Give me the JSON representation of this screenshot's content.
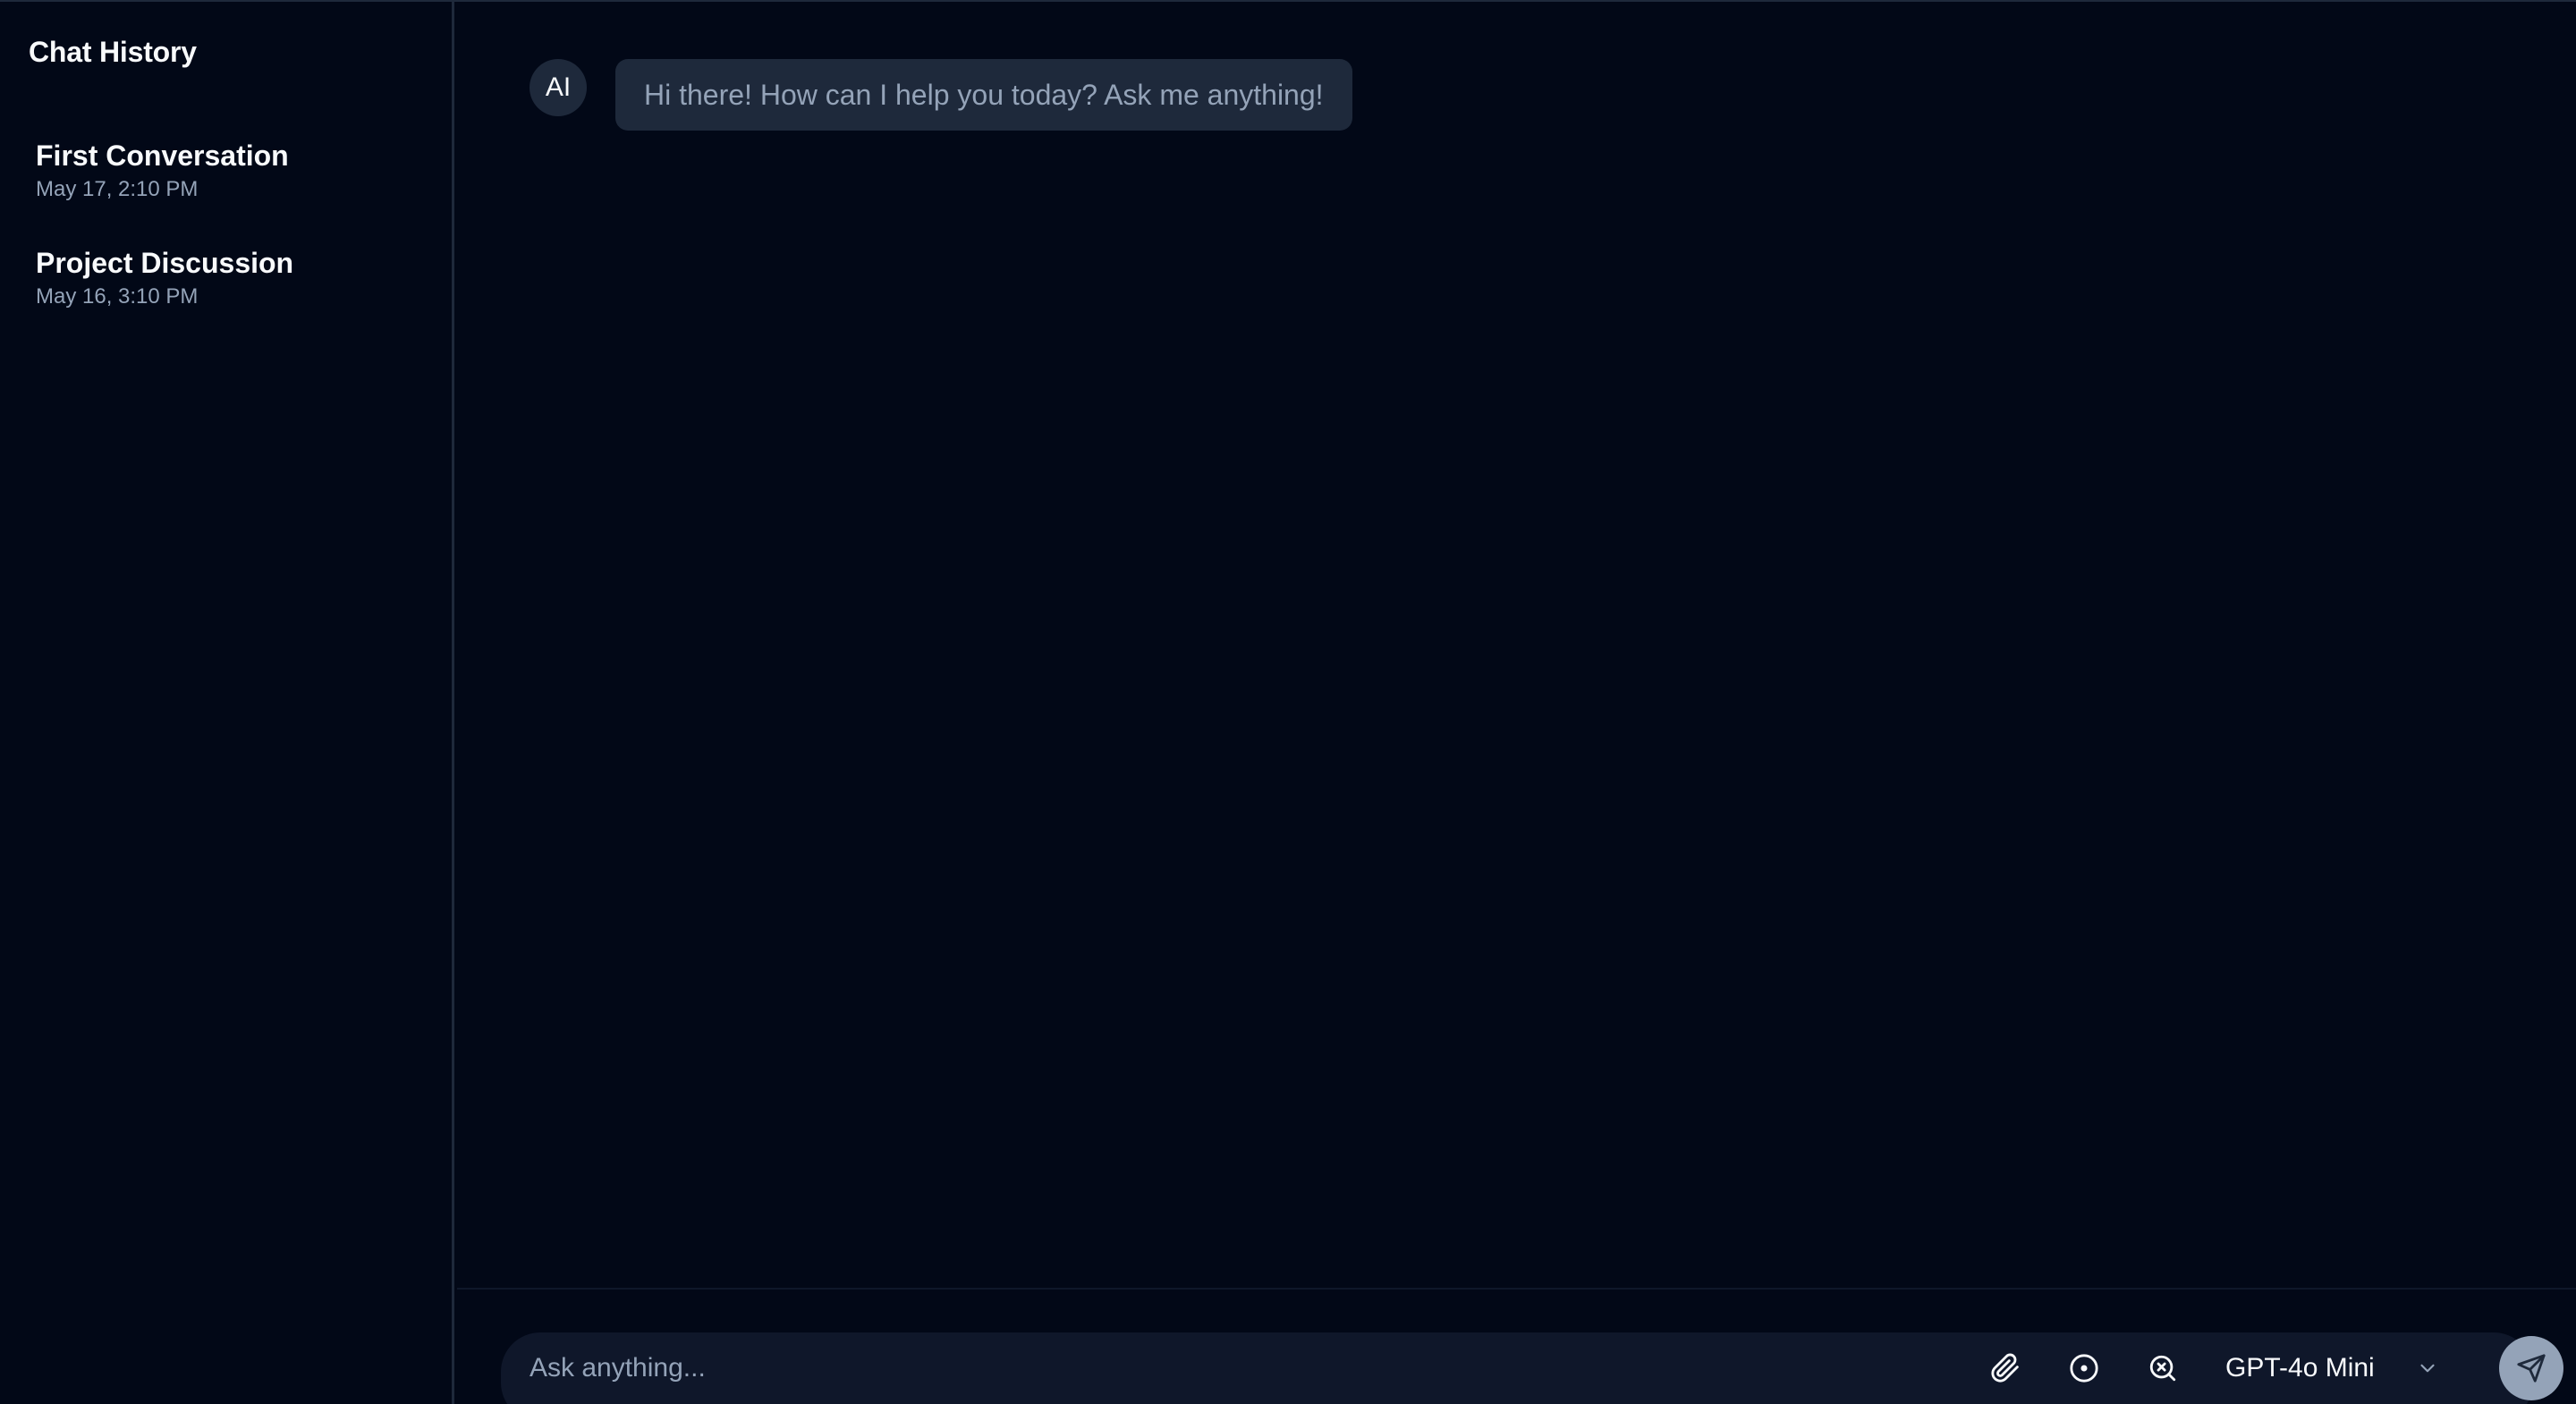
{
  "sidebar": {
    "title": "Chat History",
    "items": [
      {
        "title": "First Conversation",
        "date": "May 17, 2:10 PM"
      },
      {
        "title": "Project Discussion",
        "date": "May 16, 3:10 PM"
      }
    ]
  },
  "chat": {
    "messages": [
      {
        "role": "assistant",
        "avatar": "AI",
        "text": "Hi there! How can I help you today? Ask me anything!"
      }
    ]
  },
  "composer": {
    "placeholder": "Ask anything...",
    "value": "",
    "tools": [
      {
        "icon": "paperclip-icon"
      },
      {
        "icon": "circle-dot-icon"
      },
      {
        "icon": "search-x-icon"
      }
    ],
    "model": "GPT-4o Mini",
    "send_icon": "send-icon"
  },
  "colors": {
    "background": "#020817",
    "surface": "#1e293b",
    "input_bg": "#0f172a",
    "text": "#f8fafc",
    "muted": "#94a3b8"
  }
}
